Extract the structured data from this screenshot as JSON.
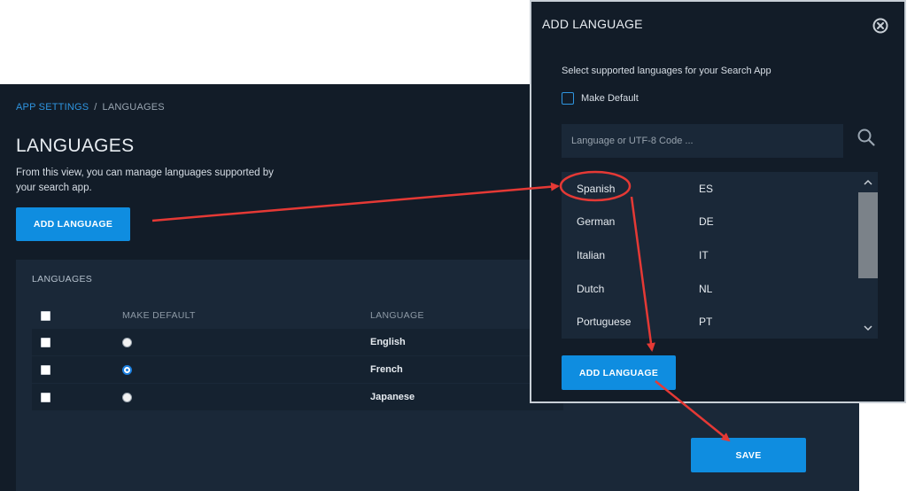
{
  "breadcrumb": {
    "parent": "APP SETTINGS",
    "separator": "/",
    "current": "LANGUAGES"
  },
  "page": {
    "title": "LANGUAGES",
    "description": "From this view, you can manage languages supported by your search app.",
    "add_button": "ADD LANGUAGE",
    "save_button": "SAVE"
  },
  "panel": {
    "title": "LANGUAGES",
    "columns": {
      "make_default": "MAKE DEFAULT",
      "language": "LANGUAGE"
    },
    "rows": [
      {
        "language": "English",
        "default": false
      },
      {
        "language": "French",
        "default": true
      },
      {
        "language": "Japanese",
        "default": false
      }
    ]
  },
  "modal": {
    "title": "ADD LANGUAGE",
    "subtitle": "Select supported languages for your Search App",
    "make_default_label": "Make Default",
    "search_placeholder": "Language or UTF-8 Code ...",
    "languages": [
      {
        "name": "Spanish",
        "code": "ES"
      },
      {
        "name": "German",
        "code": "DE"
      },
      {
        "name": "Italian",
        "code": "IT"
      },
      {
        "name": "Dutch",
        "code": "NL"
      },
      {
        "name": "Portuguese",
        "code": "PT"
      }
    ],
    "add_button": "ADD LANGUAGE"
  },
  "colors": {
    "accent": "#0f8de0",
    "annotation": "#e53935",
    "background": "#121c28"
  }
}
